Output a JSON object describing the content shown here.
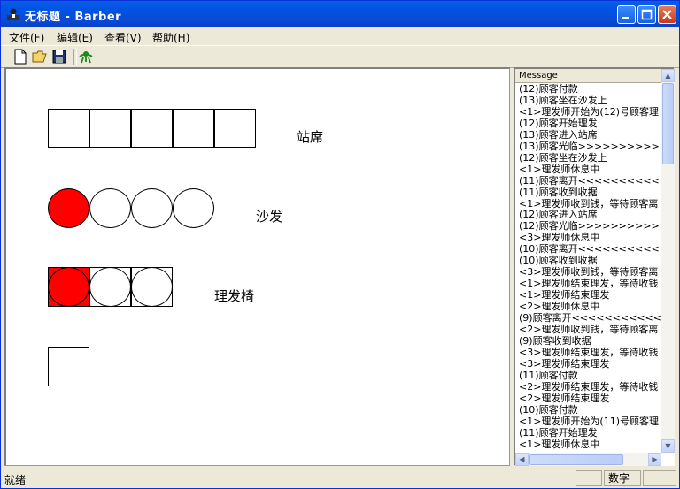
{
  "window": {
    "title": "无标题 - Barber"
  },
  "menu": [
    "文件(F)",
    "编辑(E)",
    "查看(V)",
    "帮助(H)"
  ],
  "scene": {
    "standing_label": "站席",
    "sofa_label": "沙发",
    "chair_label": "理发椅",
    "standing_slots": 5,
    "sofa_occupied": [
      true,
      false,
      false,
      false
    ],
    "chairs_occupied": [
      true,
      false,
      false
    ]
  },
  "messages": {
    "header": "Message",
    "lines": [
      "(12)顾客付款",
      "(13)顾客坐在沙发上",
      "<1>理发师开始为(12)号顾客理",
      "(12)顾客开始理发",
      "(13)顾客进入站席",
      "(13)顾客光临>>>>>>>>>>>>>",
      "(12)顾客坐在沙发上",
      "<1>理发师休息中",
      "(11)顾客离开<<<<<<<<<<<<",
      "(11)顾客收到收据",
      "<1>理发师收到钱，等待顾客离",
      "(12)顾客进入站席",
      "(12)顾客光临>>>>>>>>>>>>>",
      "<3>理发师休息中",
      "(10)顾客离开<<<<<<<<<<<<",
      "(10)顾客收到收据",
      "<3>理发师收到钱，等待顾客离",
      "<1>理发师结束理发，等待收钱",
      "<1>理发师结束理发",
      "<2>理发师休息中",
      "(9)顾客离开<<<<<<<<<<<<",
      "<2>理发师收到钱，等待顾客离",
      "(9)顾客收到收据",
      "<3>理发师结束理发，等待收钱",
      "<3>理发师结束理发",
      "(11)顾客付款",
      "<2>理发师结束理发，等待收钱",
      "<2>理发师结束理发",
      "(10)顾客付款",
      "<1>理发师开始为(11)号顾客理",
      "(11)顾客开始理发",
      "<1>理发师休息中"
    ]
  },
  "status": {
    "text": "就绪",
    "num": "数字"
  }
}
